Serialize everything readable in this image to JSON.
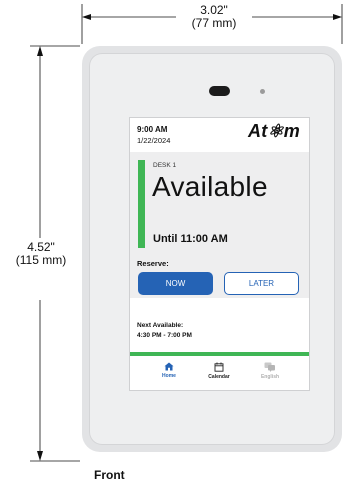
{
  "dimensions": {
    "width_inches": "3.02\"",
    "width_mm": "(77 mm)",
    "height_inches": "4.52\"",
    "height_mm": "(115 mm)"
  },
  "view_label": "Front",
  "screen": {
    "time": "9:00 AM",
    "date": "1/22/2024",
    "logo": "At⚛m",
    "desk_label": "DESK 1",
    "status": "Available",
    "until": "Until 11:00 AM",
    "reserve_label": "Reserve:",
    "now_button": "NOW",
    "later_button": "LATER",
    "next_available_label": "Next Available:",
    "next_available_time": "4:30 PM - 7:00 PM",
    "nav": {
      "home": "Home",
      "calendar": "Calendar",
      "english": "English"
    }
  },
  "colors": {
    "accent_blue": "#2563b5",
    "status_green": "#3fb655"
  }
}
